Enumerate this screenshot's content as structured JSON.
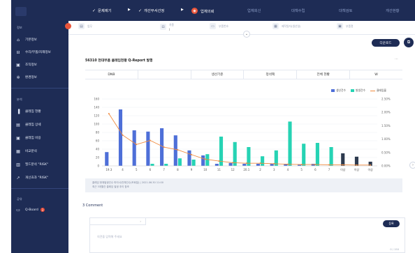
{
  "sidebar": {
    "sec1": "정보",
    "items1": [
      {
        "label": "기본정보",
        "icon": "home-icon"
      },
      {
        "label": "수리/부품/자재정보",
        "icon": "car-icon"
      },
      {
        "label": "조직정보",
        "icon": "org-icon"
      },
      {
        "label": "환경정보",
        "icon": "gear-icon"
      }
    ],
    "sec2": "분석",
    "items2": [
      {
        "label": "클레임 현황",
        "icon": "bar-chart-icon"
      },
      {
        "label": "클레임 상세",
        "icon": "list-icon"
      },
      {
        "label": "클레임 비용",
        "icon": "cost-icon"
      },
      {
        "label": "비교분석",
        "icon": "compare-icon"
      },
      {
        "label": "필드분석 \"RISK\"",
        "icon": "field-icon"
      },
      {
        "label": "개선효과 \"RISK\"",
        "icon": "trend-icon"
      }
    ],
    "sec3": "공유",
    "items3": [
      {
        "label": "Q-Board",
        "icon": "board-icon",
        "badge": "3"
      }
    ]
  },
  "steps": [
    {
      "label": "문제제기",
      "state": "done"
    },
    {
      "label": "개선부서선정",
      "state": "done"
    },
    {
      "label": "업체의뢰",
      "state": "current"
    },
    {
      "label": "업체회신",
      "state": "pending"
    },
    {
      "label": "대책수립",
      "state": "pending"
    },
    {
      "label": "대책검토",
      "state": "pending"
    },
    {
      "label": "개선현황",
      "state": "pending"
    }
  ],
  "filters": [
    {
      "label": "업무",
      "icon": "doc-icon",
      "value": ""
    },
    {
      "label": "차종",
      "icon": "car-icon",
      "value": "|"
    },
    {
      "label": "부품번호",
      "icon": "part-icon",
      "value": ""
    },
    {
      "label": "제작일자(생산일)",
      "icon": "calendar-icon",
      "value": ""
    },
    {
      "label": "부품명",
      "icon": "tag-icon",
      "value": ""
    }
  ],
  "actions": {
    "download": "다운로드"
  },
  "report": {
    "title": "56310 현대부품 클레임현황 Q-Report 발행",
    "tabs": [
      "DNB",
      "",
      "생산기준",
      "정석팩",
      "전체 현황",
      "W"
    ],
    "note_line1": "클레임 현재발생건수 마이너/전체건수(조회일) | 2021.06.30 11:00",
    "note_line2": "최근 3개월간 클레임 발생 추이 참조"
  },
  "chart_data": {
    "type": "bar",
    "categories": [
      "19.3",
      "4",
      "5",
      "6",
      "7",
      "8",
      "9",
      "10",
      "11",
      "12",
      "20.1",
      "2",
      "3",
      "4",
      "5",
      "6",
      "7",
      "이상",
      "이상",
      "이상"
    ],
    "series": [
      {
        "name": "생산건수",
        "color": "#4e6fd8",
        "values": [
          33,
          135,
          85,
          82,
          90,
          73,
          37,
          25,
          5,
          7,
          5,
          5,
          5,
          5,
          3,
          5,
          0,
          0,
          0,
          0
        ]
      },
      {
        "name": "발생건수",
        "color": "#26d3b4",
        "values": [
          0,
          0,
          0,
          5,
          5,
          18,
          15,
          28,
          70,
          57,
          45,
          23,
          37,
          106,
          53,
          55,
          45,
          0,
          0,
          0
        ]
      },
      {
        "name": "클레임율",
        "color": "#f08b3f",
        "type": "line",
        "axis": "right",
        "values": [
          1.95,
          1.15,
          0.8,
          0.95,
          0.7,
          0.6,
          0.42,
          0.25,
          0.18,
          0.12,
          0.1,
          0.1,
          0.08,
          0.06,
          0.05,
          0.05,
          0.04,
          0.04,
          0.03,
          0.03
        ]
      }
    ],
    "extra_bars": {
      "color": "#2d3a4e",
      "values": [
        0,
        0,
        0,
        0,
        0,
        0,
        0,
        0,
        0,
        0,
        0,
        0,
        0,
        0,
        0,
        0,
        0,
        30,
        22,
        10
      ]
    },
    "yticks_left": [
      "0",
      "20",
      "40",
      "60",
      "80",
      "100",
      "120",
      "140",
      "160"
    ],
    "yticks_right": [
      "0.00%",
      "0.50%",
      "1.00%",
      "1.50%",
      "2.00%",
      "2.50%"
    ],
    "ylim": [
      0,
      160
    ],
    "y2lim": [
      0,
      2.5
    ],
    "legend_position": "top-right"
  },
  "comments": {
    "header": "3 Comment",
    "placeholder": "의견을 입력해 주세요",
    "counter": "0 / 150",
    "submit": "등록"
  }
}
